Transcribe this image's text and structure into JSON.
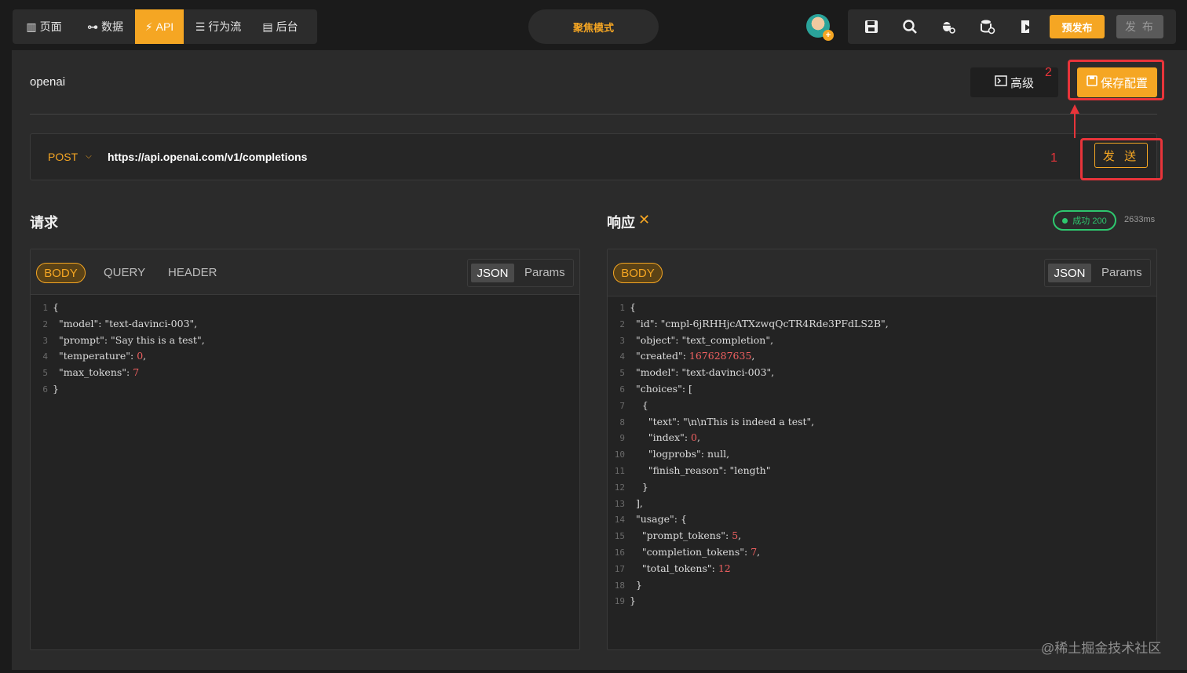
{
  "nav": {
    "items": [
      {
        "label": "页面",
        "icon": "page-icon"
      },
      {
        "label": "数据",
        "icon": "data-icon"
      },
      {
        "label": "API",
        "icon": "api-plug-icon"
      },
      {
        "label": "行为流",
        "icon": "flow-icon"
      },
      {
        "label": "后台",
        "icon": "admin-icon"
      }
    ],
    "active": "API",
    "focus_mode": "聚焦模式"
  },
  "toolbar": {
    "prepublish": "预发布",
    "publish": "发 布"
  },
  "config": {
    "name": "openai",
    "advanced": "高级",
    "save": "保存配置"
  },
  "request": {
    "method": "POST",
    "url": "https://api.openai.com/v1/completions",
    "send": "发 送",
    "title": "请求",
    "tabs": [
      "BODY",
      "QUERY",
      "HEADER"
    ],
    "format_on": "JSON",
    "format_off": "Params",
    "body_lines": [
      {
        "n": "1",
        "t": "{"
      },
      {
        "n": "2",
        "t": "  \"model\": \"text-davinci-003\","
      },
      {
        "n": "3",
        "t": "  \"prompt\": \"Say this is a test\","
      },
      {
        "n": "4",
        "t": "  \"temperature\": ",
        "v": "0",
        "e": ","
      },
      {
        "n": "5",
        "t": "  \"max_tokens\": ",
        "v": "7",
        "e": ""
      },
      {
        "n": "6",
        "t": "}"
      }
    ]
  },
  "response": {
    "title": "响应",
    "status": "成功 200",
    "timing": "2633ms",
    "tab": "BODY",
    "format_on": "JSON",
    "format_off": "Params",
    "body_lines": [
      {
        "n": "1",
        "t": "{"
      },
      {
        "n": "2",
        "t": "  \"id\": \"cmpl-6jRHHjcATXzwqQcTR4Rde3PFdLS2B\","
      },
      {
        "n": "3",
        "t": "  \"object\": \"text_completion\","
      },
      {
        "n": "4",
        "t": "  \"created\": ",
        "v": "1676287635",
        "e": ","
      },
      {
        "n": "5",
        "t": "  \"model\": \"text-davinci-003\","
      },
      {
        "n": "6",
        "t": "  \"choices\": ["
      },
      {
        "n": "7",
        "t": "    {"
      },
      {
        "n": "8",
        "t": "      \"text\": \"\\n\\nThis is indeed a test\","
      },
      {
        "n": "9",
        "t": "      \"index\": ",
        "v": "0",
        "e": ","
      },
      {
        "n": "10",
        "t": "      \"logprobs\": null,"
      },
      {
        "n": "11",
        "t": "      \"finish_reason\": \"length\""
      },
      {
        "n": "12",
        "t": "    }"
      },
      {
        "n": "13",
        "t": "  ],"
      },
      {
        "n": "14",
        "t": "  \"usage\": {"
      },
      {
        "n": "15",
        "t": "    \"prompt_tokens\": ",
        "v": "5",
        "e": ","
      },
      {
        "n": "16",
        "t": "    \"completion_tokens\": ",
        "v": "7",
        "e": ","
      },
      {
        "n": "17",
        "t": "    \"total_tokens\": ",
        "v": "12",
        "e": ""
      },
      {
        "n": "18",
        "t": "  }"
      },
      {
        "n": "19",
        "t": "}"
      }
    ]
  },
  "annotations": {
    "step1": "1",
    "step2": "2"
  },
  "watermark": "@稀土掘金技术社区",
  "colors": {
    "accent": "#f5a623",
    "success": "#2ec76e",
    "highlight": "#e8343a",
    "number": "#f06060"
  }
}
